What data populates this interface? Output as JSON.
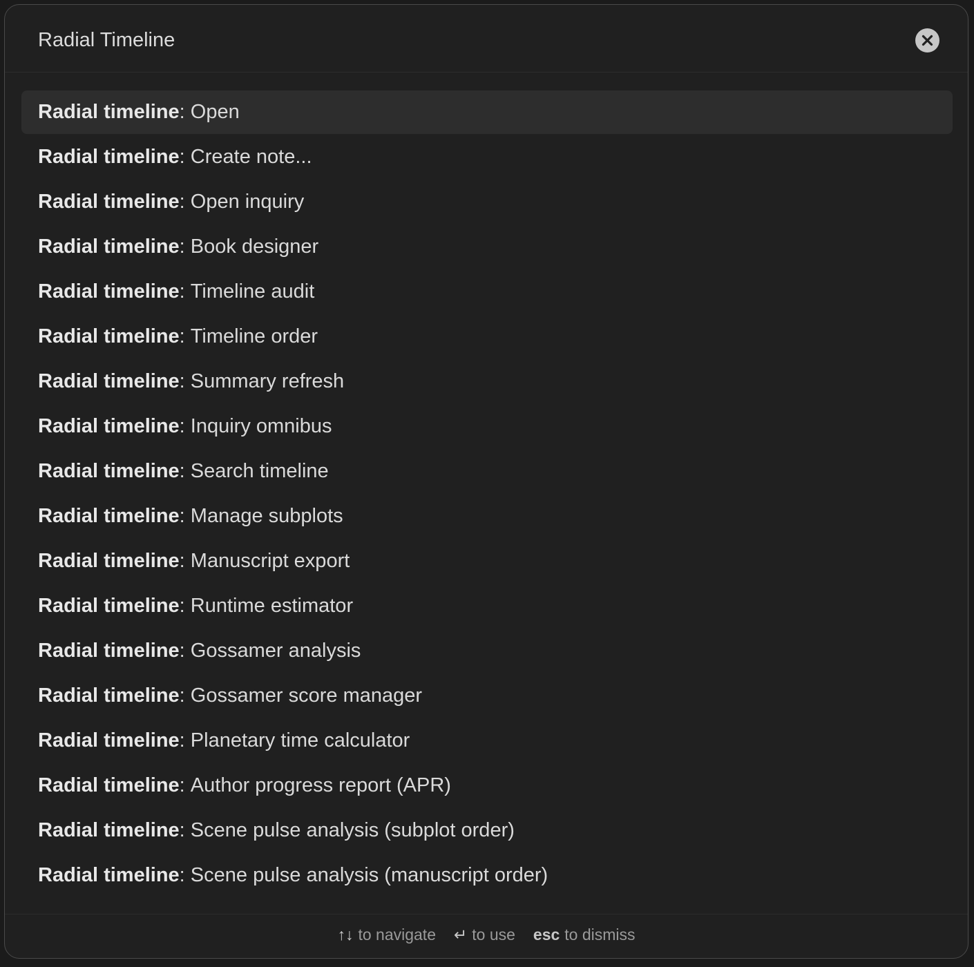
{
  "modal": {
    "title": "Radial Timeline",
    "close_icon": "close-icon"
  },
  "commands": {
    "prefix": "Radial timeline",
    "separator": ": ",
    "items": [
      {
        "label": "Open",
        "selected": true
      },
      {
        "label": "Create note..."
      },
      {
        "label": "Open inquiry"
      },
      {
        "label": "Book designer"
      },
      {
        "label": "Timeline audit"
      },
      {
        "label": "Timeline order"
      },
      {
        "label": "Summary refresh"
      },
      {
        "label": "Inquiry omnibus"
      },
      {
        "label": "Search timeline"
      },
      {
        "label": "Manage subplots"
      },
      {
        "label": "Manuscript export"
      },
      {
        "label": "Runtime estimator"
      },
      {
        "label": "Gossamer analysis"
      },
      {
        "label": "Gossamer score manager"
      },
      {
        "label": "Planetary time calculator"
      },
      {
        "label": "Author progress report (APR)"
      },
      {
        "label": "Scene pulse analysis (subplot order)"
      },
      {
        "label": "Scene pulse analysis (manuscript order)"
      }
    ]
  },
  "footer": {
    "navigate_key": "↑↓",
    "navigate_text": "to navigate",
    "use_key": "↵",
    "use_text": "to use",
    "dismiss_key": "esc",
    "dismiss_text": "to dismiss"
  },
  "colors": {
    "background": "#202020",
    "selected_row": "#2d2d2d",
    "text": "#dadada",
    "muted": "#9a9a9a"
  }
}
